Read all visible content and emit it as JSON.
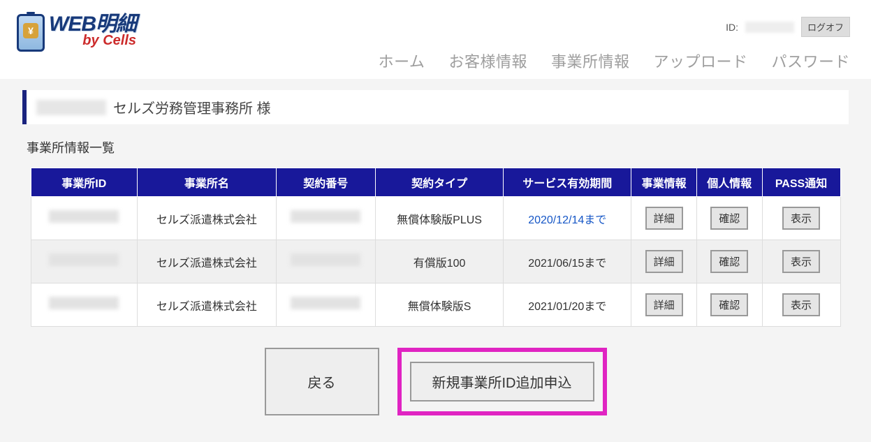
{
  "header": {
    "logo_main": "WEB明細",
    "logo_sub": "by Cells",
    "id_label": "ID:",
    "logoff": "ログオフ"
  },
  "nav": {
    "home": "ホーム",
    "customer": "お客様情報",
    "office": "事業所情報",
    "upload": "アップロード",
    "password": "パスワード"
  },
  "title": {
    "customer_name": "セルズ労務管理事務所 様"
  },
  "section": {
    "heading": "事業所情報一覧"
  },
  "table": {
    "headers": {
      "office_id": "事業所ID",
      "office_name": "事業所名",
      "contract_no": "契約番号",
      "contract_type": "契約タイプ",
      "service_term": "サービス有効期間",
      "office_info": "事業情報",
      "person_info": "個人情報",
      "pass_notice": "PASS通知"
    },
    "rows": [
      {
        "office_name": "セルズ派遣株式会社",
        "contract_type": "無償体験版PLUS",
        "service_term": "2020/12/14まで",
        "term_class": "link-blue",
        "detail": "詳細",
        "confirm": "確認",
        "show": "表示"
      },
      {
        "office_name": "セルズ派遣株式会社",
        "contract_type": "有償版100",
        "service_term": "2021/06/15まで",
        "term_class": "",
        "detail": "詳細",
        "confirm": "確認",
        "show": "表示"
      },
      {
        "office_name": "セルズ派遣株式会社",
        "contract_type": "無償体験版S",
        "service_term": "2021/01/20まで",
        "term_class": "",
        "detail": "詳細",
        "confirm": "確認",
        "show": "表示"
      }
    ]
  },
  "actions": {
    "back": "戻る",
    "add_office": "新規事業所ID追加申込"
  }
}
